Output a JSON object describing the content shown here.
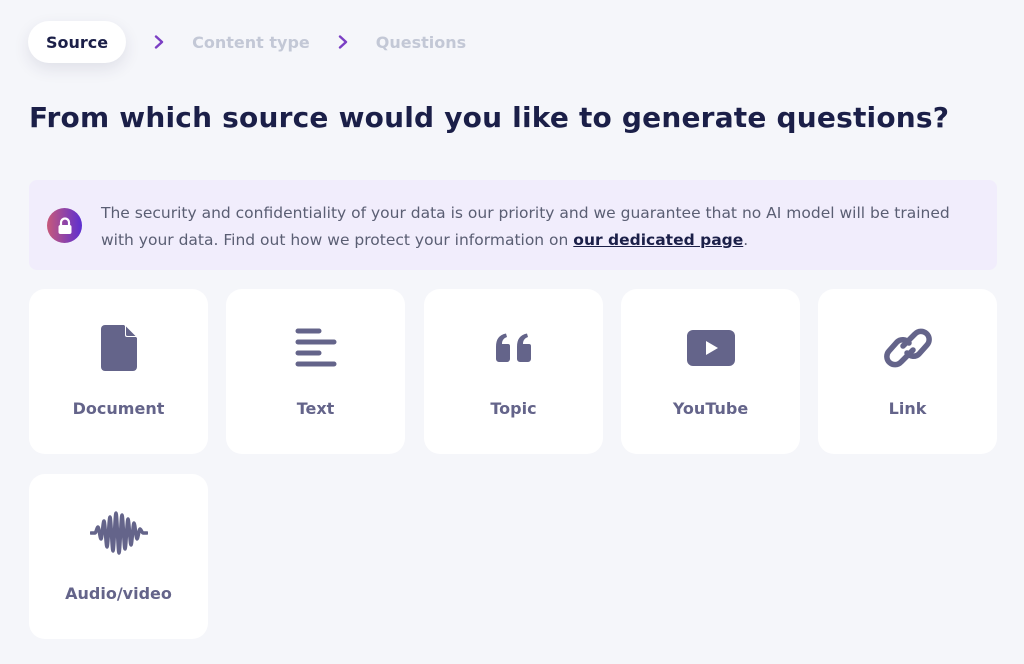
{
  "stepper": {
    "steps": [
      {
        "label": "Source",
        "state": "active"
      },
      {
        "label": "Content type",
        "state": "inactive"
      },
      {
        "label": "Questions",
        "state": "inactive"
      }
    ],
    "separator_icon": "chevron-right-icon",
    "accent_color": "#7b3fc4"
  },
  "page": {
    "title": "From which source would you like to generate questions?"
  },
  "notice": {
    "icon": "lock-icon",
    "text_before": "The security and confidentiality of your data is our priority and we guarantee that no AI model will be trained with your data. Find out how we protect your information on ",
    "link_label": "our dedicated page",
    "text_after": "."
  },
  "sources": [
    {
      "label": "Document",
      "icon": "document-icon"
    },
    {
      "label": "Text",
      "icon": "text-lines-icon"
    },
    {
      "label": "Topic",
      "icon": "quote-icon"
    },
    {
      "label": "YouTube",
      "icon": "youtube-icon"
    },
    {
      "label": "Link",
      "icon": "link-icon"
    },
    {
      "label": "Audio/video",
      "icon": "audio-wave-icon"
    }
  ],
  "colors": {
    "background": "#f5f6fa",
    "heading": "#1b1f48",
    "icon": "#64648a",
    "notice_bg": "#f1edfc"
  }
}
